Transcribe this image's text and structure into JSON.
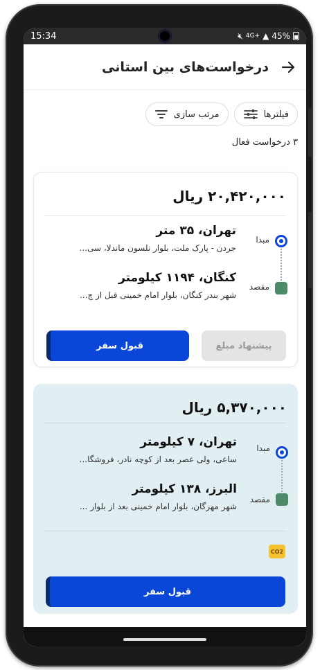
{
  "status_bar": {
    "time": "15:34",
    "network": "4G+",
    "battery": "45%"
  },
  "header": {
    "title": "درخواست‌های بین استانی"
  },
  "filters": {
    "filter_label": "فیلترها",
    "sort_label": "مرتب سازی"
  },
  "active_count": "۳ درخواست فعال",
  "requests": [
    {
      "price": "۲۰,۴۲۰,۰۰۰ ریال",
      "origin_label": "مبدا",
      "origin_title": "تهران، ۳۵ متر",
      "origin_address": "جردن - پارک ملت، بلوار نلسون ماندلا، سی...",
      "dest_label": "مقصد",
      "dest_title": "کنگان، ۱۱۹۴ کیلومتر",
      "dest_address": "شهر بندر کنگان، بلوار امام خمینی قبل از چ...",
      "offer_label": "پیشنهاد مبلغ",
      "accept_label": "قبول سفر"
    },
    {
      "price": "۵,۳۷۰,۰۰۰ ریال",
      "origin_label": "مبدا",
      "origin_title": "تهران، ۷ کیلومتر",
      "origin_address": "ساعی، ولی عصر بعد از کوچه نادر، فروشگا...",
      "dest_label": "مقصد",
      "dest_title": "البرز، ۱۳۸ کیلومتر",
      "dest_address": "شهر مهرگان، بلوار امام خمینی بعد از بلوار ...",
      "badge": "CO2",
      "accept_label": "قبول سفر"
    }
  ],
  "colors": {
    "accent": "#0a46d8",
    "card2_bg": "#e1eef2",
    "disabled": "#e4e4e4"
  }
}
